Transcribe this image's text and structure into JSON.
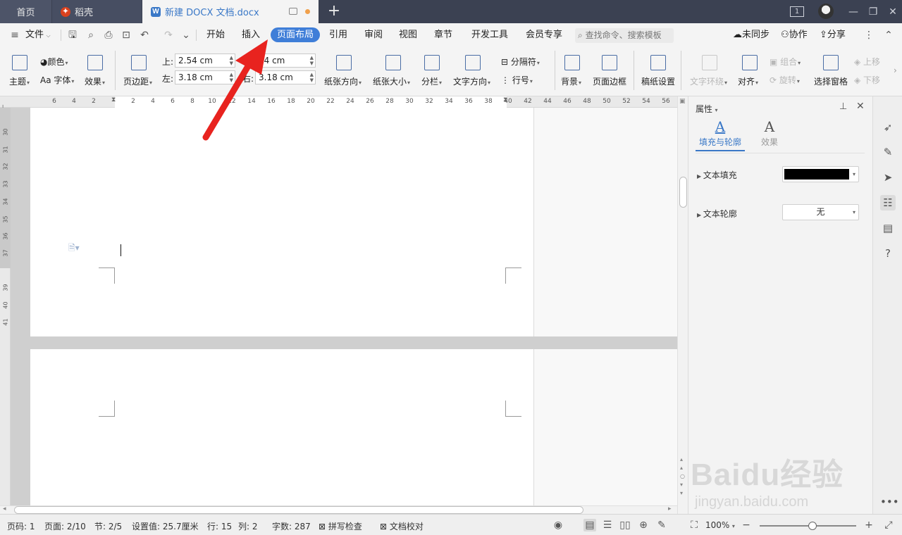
{
  "titlebar": {
    "tabs": [
      {
        "label": "首页"
      },
      {
        "label": "稻壳"
      },
      {
        "label": "新建 DOCX 文档.docx"
      }
    ],
    "new_tab": "+",
    "layout_badge": "1"
  },
  "menubar": {
    "file": "文件",
    "tabs": [
      "开始",
      "插入",
      "页面布局",
      "引用",
      "审阅",
      "视图",
      "章节",
      "开发工具",
      "会员专享"
    ],
    "active_tab": "页面布局",
    "search_placeholder": "查找命令、搜索模板",
    "sync": "未同步",
    "collab": "协作",
    "share": "分享"
  },
  "ribbon": {
    "theme": "主题",
    "color": "颜色",
    "font": "Aa 字体",
    "effect": "效果",
    "margins": "页边距",
    "top_label": "上:",
    "top_value": "2.54 cm",
    "bottom_value": "54 cm",
    "left_label": "左:",
    "left_value": "3.18 cm",
    "right_value": "3.18 cm",
    "right_label": "右:",
    "orientation": "纸张方向",
    "size": "纸张大小",
    "columns": "分栏",
    "text_direction": "文字方向",
    "breaks": "分隔符",
    "line_numbers": "行号",
    "background": "背景",
    "page_border": "页面边框",
    "manuscript": "稿纸设置",
    "text_wrap": "文字环绕",
    "align": "对齐",
    "group": "组合",
    "rotate": "旋转",
    "selection_pane": "选择窗格",
    "bring_forward": "上移",
    "send_backward": "下移"
  },
  "ruler": {
    "h_left": [
      "6",
      "4",
      "2"
    ],
    "h_right": [
      "2",
      "4",
      "6",
      "8",
      "10",
      "12",
      "14",
      "16",
      "18",
      "20",
      "22",
      "24",
      "26",
      "28",
      "30",
      "32",
      "34",
      "36",
      "38",
      "40",
      "42",
      "44",
      "46",
      "48",
      "50",
      "52",
      "54",
      "56"
    ],
    "v": [
      "30",
      "31",
      "32",
      "33",
      "34",
      "35",
      "36",
      "37",
      "39",
      "40",
      "41"
    ]
  },
  "panel": {
    "title": "属性",
    "tab_fill": "填充与轮廓",
    "tab_effect": "效果",
    "text_fill": "文本填充",
    "text_fill_color": "#000000",
    "text_outline": "文本轮廓",
    "text_outline_value": "无"
  },
  "status": {
    "page_no": "页码: 1",
    "pages": "页面: 2/10",
    "section": "节: 2/5",
    "setting": "设置值: 25.7厘米",
    "row": "行: 15",
    "col": "列: 2",
    "words": "字数: 287",
    "spell": "拼写检查",
    "proof": "文档校对",
    "zoom": "100%",
    "zoom_fraction": 0.5
  },
  "watermark": {
    "brand": "Baidu经验",
    "url": "jingyan.baidu.com"
  },
  "colors": {
    "accent": "#3f7ed8",
    "arrow": "#e8231f"
  }
}
